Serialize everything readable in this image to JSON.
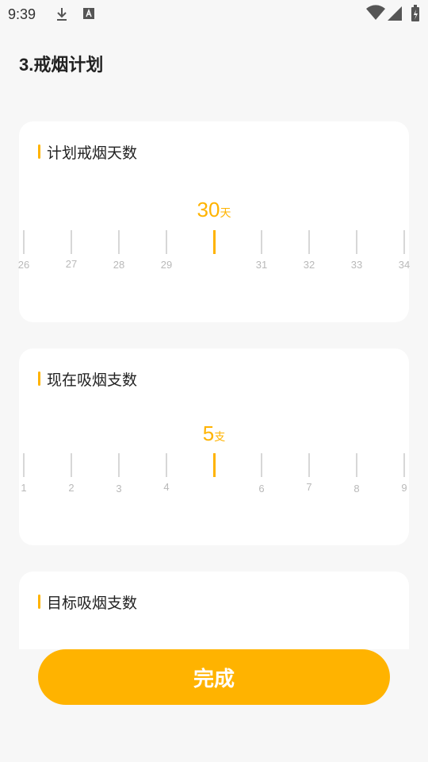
{
  "status": {
    "time": "9:39",
    "icons": [
      "download-icon",
      "a-icon",
      "wifi-icon",
      "signal-icon",
      "battery-icon"
    ]
  },
  "page": {
    "title": "3.戒烟计划"
  },
  "cards": [
    {
      "title": "计划戒烟天数",
      "value": "30",
      "unit": "天",
      "ticks": [
        "26",
        "27",
        "28",
        "29",
        "30",
        "31",
        "32",
        "33",
        "34"
      ]
    },
    {
      "title": "现在吸烟支数",
      "value": "5",
      "unit": "支",
      "ticks": [
        "1",
        "2",
        "3",
        "4",
        "5",
        "6",
        "7",
        "8",
        "9"
      ]
    },
    {
      "title": "目标吸烟支数"
    }
  ],
  "footer": {
    "button_label": "完成"
  },
  "colors": {
    "accent": "#ffb300",
    "background": "#f7f7f7",
    "card": "#ffffff",
    "tick": "#d7d7d7"
  }
}
